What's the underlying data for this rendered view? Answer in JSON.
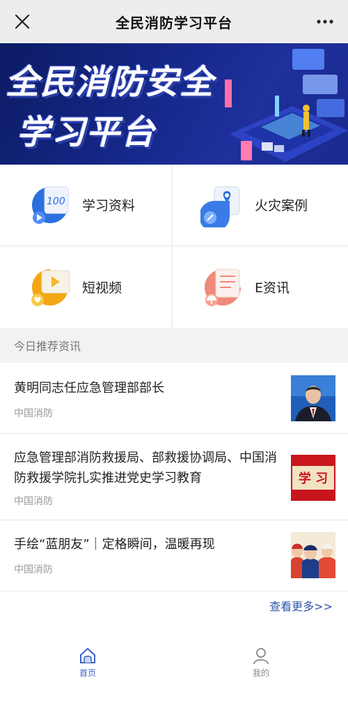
{
  "topbar": {
    "title": "全民消防学习平台"
  },
  "banner": {
    "line1": "全民消防安全",
    "line2": "学习平台"
  },
  "grid": [
    {
      "label": "学习资料",
      "icon": "study-materials-icon"
    },
    {
      "label": "火灾案例",
      "icon": "fire-cases-icon"
    },
    {
      "label": "短视频",
      "icon": "short-video-icon"
    },
    {
      "label": "E资讯",
      "icon": "e-news-icon"
    }
  ],
  "section": {
    "title": "今日推荐资讯"
  },
  "news": [
    {
      "title": "黄明同志任应急管理部部长",
      "source": "中国消防"
    },
    {
      "title": "应急管理部消防救援局、部救援协调局、中国消防救援学院扎实推进党史学习教育",
      "source": "中国消防"
    },
    {
      "title": "手绘“蓝朋友”｜定格瞬间，温暖再现",
      "source": "中国消防"
    }
  ],
  "thumb2_text": "学 习",
  "more_link": "查看更多>>",
  "tabbar": {
    "home": "首页",
    "mine": "我的"
  },
  "colors": {
    "accent": "#3b63c9",
    "link": "#2b57a8"
  }
}
